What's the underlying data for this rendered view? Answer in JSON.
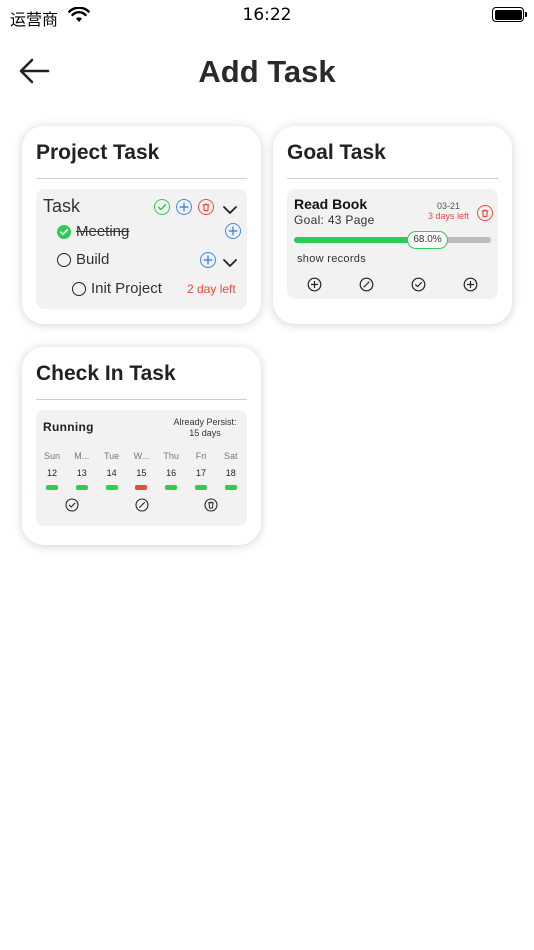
{
  "status_bar": {
    "carrier": "运营商",
    "time": "16:22"
  },
  "header": {
    "title": "Add Task",
    "back_icon": "arrow-left-icon"
  },
  "colors": {
    "green": "#2ecc55",
    "blue": "#3c8ce6",
    "red": "#e74c3c",
    "gray_bg": "#f2f2f2"
  },
  "project_task": {
    "title": "Project Task",
    "task_label": "Task",
    "items": [
      {
        "label": "Meeting",
        "done": true
      },
      {
        "label": "Build",
        "done": false
      },
      {
        "label": "Init Project",
        "done": false,
        "days_left": "2 day left"
      }
    ]
  },
  "goal_task": {
    "title": "Goal Task",
    "name": "Read Book",
    "goal": "Goal: 43 Page",
    "date": "03-21",
    "days_left": "3 days left",
    "progress_label": "68.0%",
    "progress": 0.68,
    "show_records": "show records"
  },
  "checkin_task": {
    "title": "Check In Task",
    "status": "Running",
    "persist_label": "Already Persist:",
    "persist_value": "15 days",
    "days": [
      {
        "name": "Sun",
        "num": "12",
        "state": "done"
      },
      {
        "name": "M...",
        "num": "13",
        "state": "done"
      },
      {
        "name": "Tue",
        "num": "14",
        "state": "done"
      },
      {
        "name": "W...",
        "num": "15",
        "state": "missed"
      },
      {
        "name": "Thu",
        "num": "16",
        "state": "done"
      },
      {
        "name": "Fri",
        "num": "17",
        "state": "done"
      },
      {
        "name": "Sat",
        "num": "18",
        "state": "done"
      }
    ]
  }
}
